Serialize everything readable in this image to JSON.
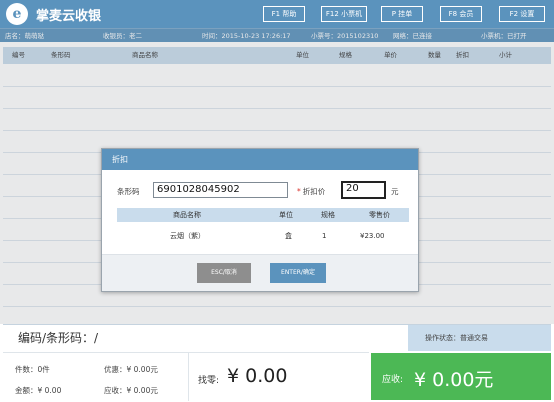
{
  "app": {
    "logo_glyph": "e",
    "title": "掌麦云收银"
  },
  "function_keys": [
    {
      "label": "F1 帮助"
    },
    {
      "label": "F12 小票机"
    },
    {
      "label": "P 挂单"
    },
    {
      "label": "F8 会员"
    },
    {
      "label": "F2 设置"
    }
  ],
  "info": {
    "store": "店名：萌萌哒",
    "cashier": "收银员：老二",
    "time": "时间：2015-10-23 17:26:17",
    "ticket_no": "小票号：2015102310",
    "network": "网络：已连接",
    "printer": "小票机：已打开"
  },
  "grid": {
    "columns": [
      "编号",
      "条形码",
      "商品名称",
      "单位",
      "规格",
      "单价",
      "数量",
      "折扣",
      "小计"
    ]
  },
  "dialog": {
    "title": "折扣",
    "barcode_label": "条形码",
    "barcode_value": "6901028045902",
    "discount_label": "折扣价",
    "discount_value": "20",
    "unit_suffix": "元",
    "table": {
      "headers": [
        "商品名称",
        "单位",
        "规格",
        "零售价"
      ],
      "row": {
        "name": "云烟（紫）",
        "unit": "盒",
        "spec": "1",
        "price": "¥23.00"
      }
    },
    "esc_label": "ESC/取消",
    "enter_label": "ENTER/确定"
  },
  "code_bar": {
    "label": "编码/条形码：/",
    "op_state": "操作状态：普通交易"
  },
  "summary": {
    "count": "件数：0件",
    "discount": "优惠：¥ 0.00元",
    "amount": "金额：¥ 0.00",
    "receivable": "应收：¥ 0.00元",
    "change_label": "找零:",
    "change_value": "¥ 0.00",
    "paid_label": "应收:",
    "paid_value": "¥ 0.00元"
  },
  "colors": {
    "primary": "#5b93bd",
    "header_row": "#c9dcec",
    "paid": "#4cb855"
  }
}
